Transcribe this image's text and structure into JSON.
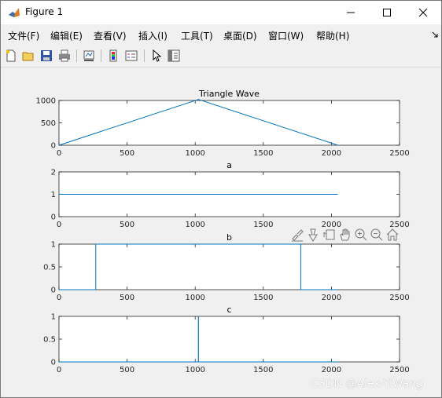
{
  "window": {
    "title": "Figure 1"
  },
  "menu": [
    "文件(F)",
    "编辑(E)",
    "查看(V)",
    "插入(I)",
    "工具(T)",
    "桌面(D)",
    "窗口(W)",
    "帮助(H)"
  ],
  "toolbar": {
    "icons": [
      "new-figure-icon",
      "open-file-icon",
      "save-icon",
      "print-icon",
      "link-plot-icon",
      "insert-colorbar-icon",
      "insert-legend-icon",
      "edit-plot-icon",
      "open-property-inspector-icon"
    ]
  },
  "axes_toolbar": {
    "icons": [
      "brush-icon",
      "data-tips-icon",
      "rotate-icon",
      "pan-icon",
      "zoom-in-icon",
      "zoom-out-icon",
      "home-icon"
    ]
  },
  "watermark": "CSDN @Alex-YiWang",
  "chart_data": [
    {
      "type": "line",
      "title": "Triangle Wave",
      "xlim": [
        0,
        2500
      ],
      "ylim": [
        0,
        1000
      ],
      "xticks": [
        "0",
        "500",
        "1000",
        "1500",
        "2000",
        "2500"
      ],
      "yticks": [
        "0",
        "500",
        "1000"
      ],
      "series": [
        {
          "x": [
            0,
            1024,
            2047
          ],
          "y": [
            0,
            1023,
            0
          ]
        }
      ]
    },
    {
      "type": "line",
      "title": "a",
      "xlim": [
        0,
        2500
      ],
      "ylim": [
        0,
        2
      ],
      "xticks": [
        "0",
        "500",
        "1000",
        "1500",
        "2000",
        "2500"
      ],
      "yticks": [
        "0",
        "1",
        "2"
      ],
      "series": [
        {
          "x": [
            0,
            2047
          ],
          "y": [
            1,
            1
          ]
        }
      ]
    },
    {
      "type": "line",
      "title": "b",
      "xlim": [
        0,
        2500
      ],
      "ylim": [
        0,
        1
      ],
      "xticks": [
        "0",
        "500",
        "1000",
        "1500",
        "2000",
        "2500"
      ],
      "yticks": [
        "0",
        "0.5",
        "1"
      ],
      "series": [
        {
          "x": [
            0,
            270,
            270,
            1775,
            1775,
            2047
          ],
          "y": [
            0,
            0,
            1,
            1,
            0,
            0
          ]
        }
      ]
    },
    {
      "type": "line",
      "title": "c",
      "xlim": [
        0,
        2500
      ],
      "ylim": [
        0,
        1
      ],
      "xticks": [
        "0",
        "500",
        "1000",
        "1500",
        "2000",
        "2500"
      ],
      "yticks": [
        "0",
        "0.5",
        "1"
      ],
      "series": [
        {
          "x": [
            0,
            1023,
            1023,
            1024,
            1024,
            2047
          ],
          "y": [
            0,
            0,
            1,
            1,
            0,
            0
          ]
        }
      ]
    }
  ]
}
